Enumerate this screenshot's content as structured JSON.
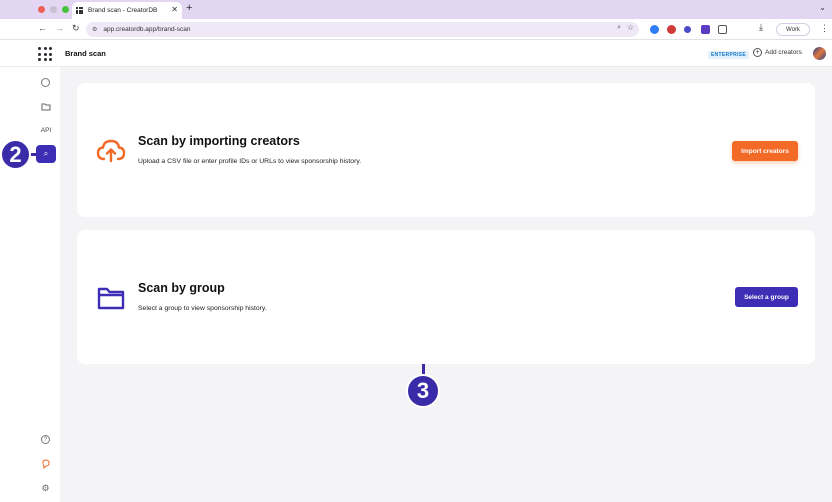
{
  "browser": {
    "tab_title": "Brand scan - CreatorDB",
    "url": "app.creatordb.app/brand-scan",
    "profile_label": "Work"
  },
  "header": {
    "page_title": "Brand scan",
    "plan_badge": "ENTERPRISE",
    "add_creators_label": "Add creators"
  },
  "sidebar": {
    "api_label": "API"
  },
  "callouts": {
    "step_a": "2",
    "step_b": "3"
  },
  "import_card": {
    "title": "Scan by importing creators",
    "description": "Upload a CSV file or enter profile IDs or URLs to view sponsorship history.",
    "button_label": "Import creators"
  },
  "group_card": {
    "title": "Scan by group",
    "description": "Select a group to view sponsorship history.",
    "button_label": "Select a group"
  },
  "colors": {
    "accent_orange": "#f26a26",
    "accent_purple": "#3e2db5"
  }
}
